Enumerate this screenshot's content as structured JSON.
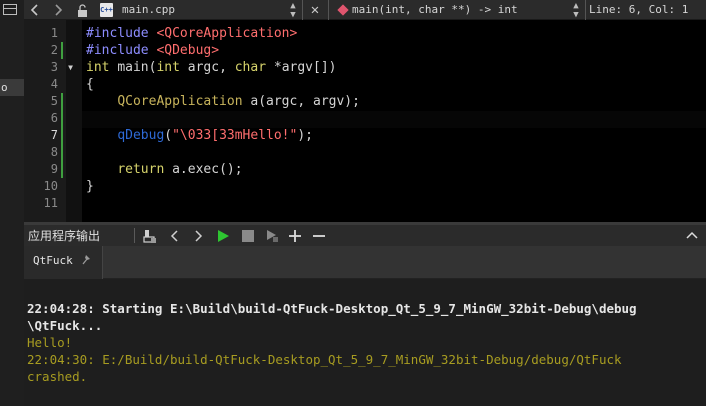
{
  "left_rail": {
    "selected_text": "o"
  },
  "editor_toolbar": {
    "file_name": "main.cpp",
    "function_symbol": "main(int, char **) -> int",
    "cursor_position": "Line: 6, Col: 1",
    "icons": [
      "back-arrow-icon",
      "forward-arrow-icon",
      "lock-icon",
      "cpp-file-icon",
      "up-down-icon",
      "close-icon",
      "function-symbol-icon"
    ]
  },
  "editor": {
    "line_numbers": [
      "1",
      "2",
      "3",
      "4",
      "5",
      "6",
      "7",
      "8",
      "9",
      "10",
      "11"
    ],
    "current_line": 7,
    "lines": [
      [
        {
          "t": "#include ",
          "c": "kw-prep"
        },
        {
          "t": "<QCoreApplication>",
          "c": "str"
        }
      ],
      [
        {
          "t": "#include ",
          "c": "kw-prep"
        },
        {
          "t": "<QDebug>",
          "c": "str"
        }
      ],
      [
        {
          "t": "int ",
          "c": "kw-type"
        },
        {
          "t": "main(",
          "c": "fn"
        },
        {
          "t": "int ",
          "c": "kw-type"
        },
        {
          "t": "argc, ",
          "c": "fn"
        },
        {
          "t": "char ",
          "c": "kw-type"
        },
        {
          "t": "*argv[])",
          "c": "fn"
        }
      ],
      [
        {
          "t": "{",
          "c": "fn"
        }
      ],
      [
        {
          "t": "    ",
          "c": "fn"
        },
        {
          "t": "QCoreApplication",
          "c": "cls"
        },
        {
          "t": " a(argc, argv);",
          "c": "fn"
        }
      ],
      [],
      [
        {
          "t": "    ",
          "c": "fn"
        },
        {
          "t": "qDebug",
          "c": "ph"
        },
        {
          "t": "(",
          "c": "fn"
        },
        {
          "t": "\"\\033[33mHello!\"",
          "c": "str"
        },
        {
          "t": ");",
          "c": "fn"
        }
      ],
      [],
      [
        {
          "t": "    ",
          "c": "fn"
        },
        {
          "t": "return ",
          "c": "kw-type"
        },
        {
          "t": "a.exec();",
          "c": "fn"
        }
      ],
      [
        {
          "t": "}",
          "c": "fn"
        }
      ],
      []
    ]
  },
  "output_panel": {
    "title": "应用程序输出",
    "tab_label": "QtFuck",
    "lines": [
      {
        "text": "22:04:28: Starting E:\\Build\\build-QtFuck-Desktop_Qt_5_9_7_MinGW_32bit-Debug\\debug",
        "style": "out-bold"
      },
      {
        "text": "\\QtFuck...",
        "style": "out-bold"
      },
      {
        "text": "Hello!",
        "style": "out-ok"
      },
      {
        "text": "22:04:30: E:/Build/build-QtFuck-Desktop_Qt_5_9_7_MinGW_32bit-Debug/debug/QtFuck",
        "style": "out-err"
      },
      {
        "text": "crashed.",
        "style": "out-err"
      }
    ]
  },
  "colors": {
    "background": "#1e1e1e",
    "code_background": "#000000",
    "preprocessor": "#8d8dff",
    "keyword": "#d6d36b",
    "string": "#ff6e6e",
    "run_green": "#2ec531",
    "output_yellow": "#a79c21"
  }
}
